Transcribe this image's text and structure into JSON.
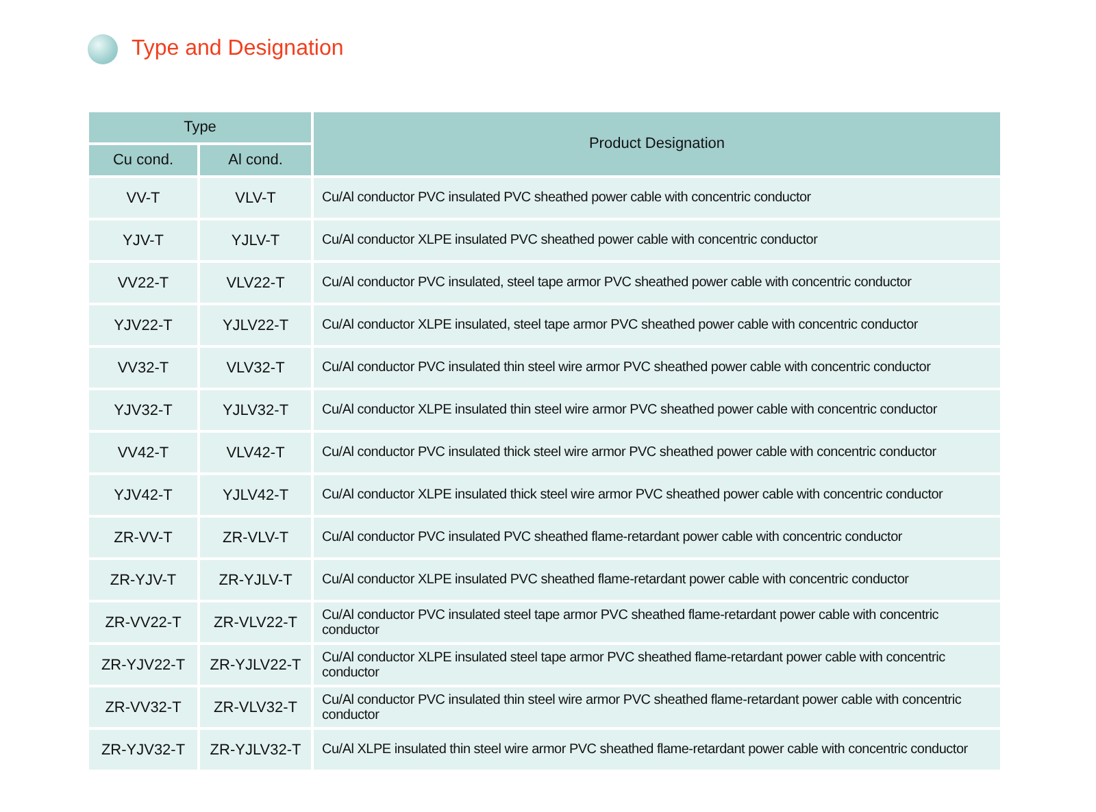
{
  "title": "Type and Designation",
  "table": {
    "group_header": "Type",
    "columns": [
      "Cu cond.",
      "Al cond.",
      "Product Designation"
    ],
    "rows": [
      [
        "VV-T",
        "VLV-T",
        "Cu/Al conductor PVC insulated PVC sheathed power cable with concentric conductor"
      ],
      [
        "YJV-T",
        "YJLV-T",
        "Cu/Al conductor XLPE insulated PVC sheathed power cable with concentric conductor"
      ],
      [
        "VV22-T",
        "VLV22-T",
        "Cu/Al conductor PVC insulated, steel tape armor PVC sheathed power cable with concentric conductor"
      ],
      [
        "YJV22-T",
        "YJLV22-T",
        "Cu/Al conductor XLPE insulated, steel tape armor PVC sheathed power cable with concentric conductor"
      ],
      [
        "VV32-T",
        "VLV32-T",
        "Cu/Al conductor PVC insulated thin steel wire armor PVC sheathed power cable with concentric conductor"
      ],
      [
        "YJV32-T",
        "YJLV32-T",
        "Cu/Al conductor XLPE insulated thin steel wire armor PVC sheathed power cable with concentric conductor"
      ],
      [
        "VV42-T",
        "VLV42-T",
        "Cu/Al conductor PVC insulated thick steel wire armor PVC sheathed power cable with concentric conductor"
      ],
      [
        "YJV42-T",
        "YJLV42-T",
        "Cu/Al conductor XLPE insulated thick steel wire armor PVC sheathed power cable with concentric conductor"
      ],
      [
        "ZR-VV-T",
        "ZR-VLV-T",
        "Cu/Al conductor PVC insulated PVC sheathed flame-retardant power cable with concentric conductor"
      ],
      [
        "ZR-YJV-T",
        "ZR-YJLV-T",
        "Cu/Al conductor XLPE insulated PVC sheathed flame-retardant power cable with concentric conductor"
      ],
      [
        "ZR-VV22-T",
        "ZR-VLV22-T",
        "Cu/Al conductor PVC insulated steel tape armor PVC sheathed flame-retardant power cable with concentric conductor"
      ],
      [
        "ZR-YJV22-T",
        "ZR-YJLV22-T",
        "Cu/Al conductor XLPE insulated steel tape armor PVC sheathed flame-retardant power cable with concentric conductor"
      ],
      [
        "ZR-VV32-T",
        "ZR-VLV32-T",
        "Cu/Al conductor PVC insulated thin steel wire armor PVC sheathed flame-retardant power cable with concentric conductor"
      ],
      [
        "ZR-YJV32-T",
        "ZR-YJLV32-T",
        "Cu/Al XLPE insulated thin steel wire armor PVC sheathed flame-retardant power cable with concentric conductor"
      ]
    ]
  }
}
